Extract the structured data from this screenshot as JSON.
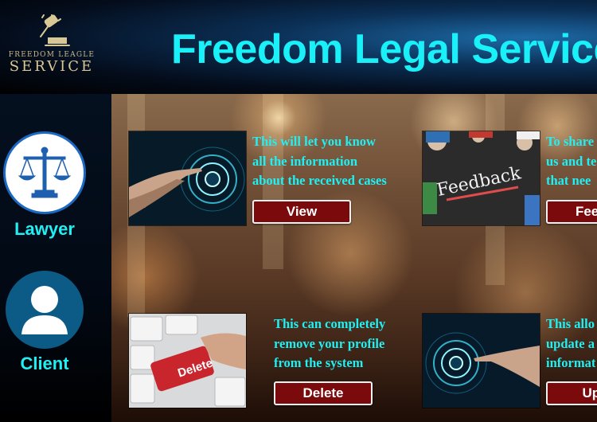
{
  "header": {
    "title": "Freedom Legal Service",
    "logo": {
      "line1": "FREEDOM LEAGLE",
      "line2": "SERVICE",
      "icon": "gavel-icon"
    }
  },
  "sidebar": {
    "items": [
      {
        "label": "Lawyer",
        "icon": "scales-of-justice-icon"
      },
      {
        "label": "Client",
        "icon": "user-avatar-icon"
      }
    ]
  },
  "cards": [
    {
      "text": [
        "This will let you know",
        "all the information",
        "about the received cases"
      ],
      "button": "View",
      "image": "hand-touching-digital-interface"
    },
    {
      "text": [
        "To share",
        "us and te",
        "that nee"
      ],
      "button": "Feedb",
      "image": "feedback-chalkboard"
    },
    {
      "text": [
        "This can completely",
        "remove your profile",
        "from the system"
      ],
      "button": "Delete",
      "image": "delete-key-keyboard"
    },
    {
      "text": [
        "This allo",
        "update a",
        "informat"
      ],
      "button": "Upd",
      "image": "hand-touching-digital-interface"
    }
  ],
  "colors": {
    "accent": "#1ff0f4",
    "button_bg": "#7a0a0c",
    "button_border": "#f2f2f2"
  }
}
